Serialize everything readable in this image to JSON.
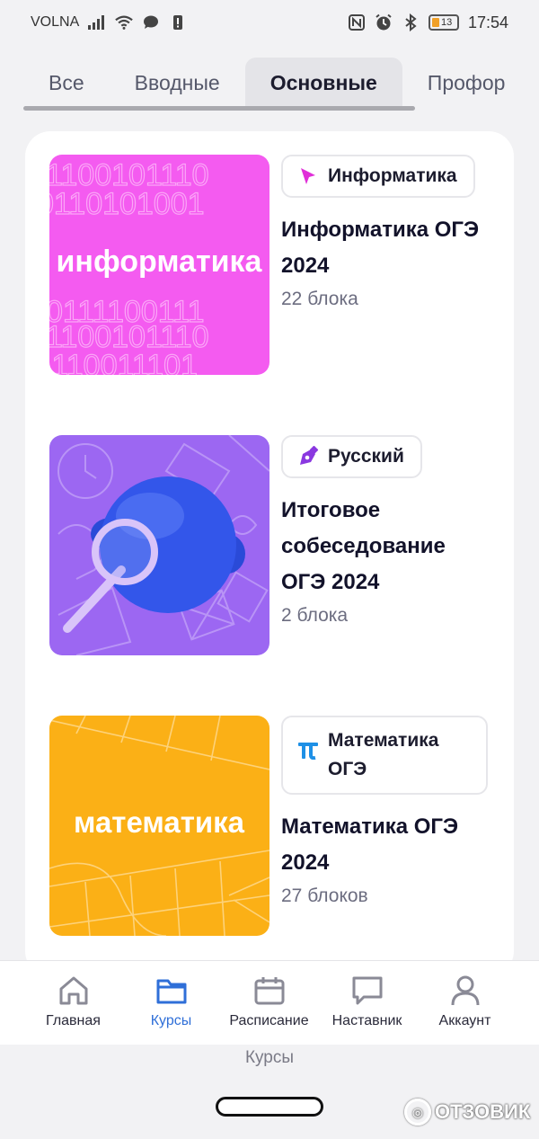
{
  "status_bar": {
    "carrier": "VOLNA",
    "battery_level": "13",
    "time": "17:54"
  },
  "tabs": [
    {
      "label": "Все",
      "active": false
    },
    {
      "label": "Вводные",
      "active": false
    },
    {
      "label": "Основные",
      "active": true
    },
    {
      "label": "Профор",
      "active": false
    }
  ],
  "courses": [
    {
      "thumb_text": "информатика",
      "subject": "Информатика",
      "subject_icon": "cursor-arrow-icon",
      "title": "Информатика ОГЭ 2024",
      "meta": "22 блока",
      "color": "#f45bf0"
    },
    {
      "thumb_text": "",
      "subject": "Русский",
      "subject_icon": "pen-nib-icon",
      "title": "Итоговое собеседование ОГЭ 2024",
      "meta": "2 блока",
      "color": "#9c67f2"
    },
    {
      "thumb_text": "математика",
      "subject": "Математика ОГЭ",
      "subject_icon": "pi-icon",
      "title": "Математика ОГЭ 2024",
      "meta": "27 блоков",
      "color": "#fbb016"
    }
  ],
  "bottom_nav": [
    {
      "label": "Главная",
      "icon": "home-icon",
      "active": false
    },
    {
      "label": "Курсы",
      "icon": "folder-icon",
      "active": true
    },
    {
      "label": "Расписание",
      "icon": "calendar-icon",
      "active": false
    },
    {
      "label": "Наставник",
      "icon": "chat-icon",
      "active": false
    },
    {
      "label": "Аккаунт",
      "icon": "user-icon",
      "active": false
    }
  ],
  "caption": "Курсы",
  "watermark": "ОТЗОВИК",
  "colors": {
    "accent": "#2f6fd8",
    "informatics": "#f45bf0",
    "russian": "#9c67f2",
    "math": "#fbb016"
  }
}
